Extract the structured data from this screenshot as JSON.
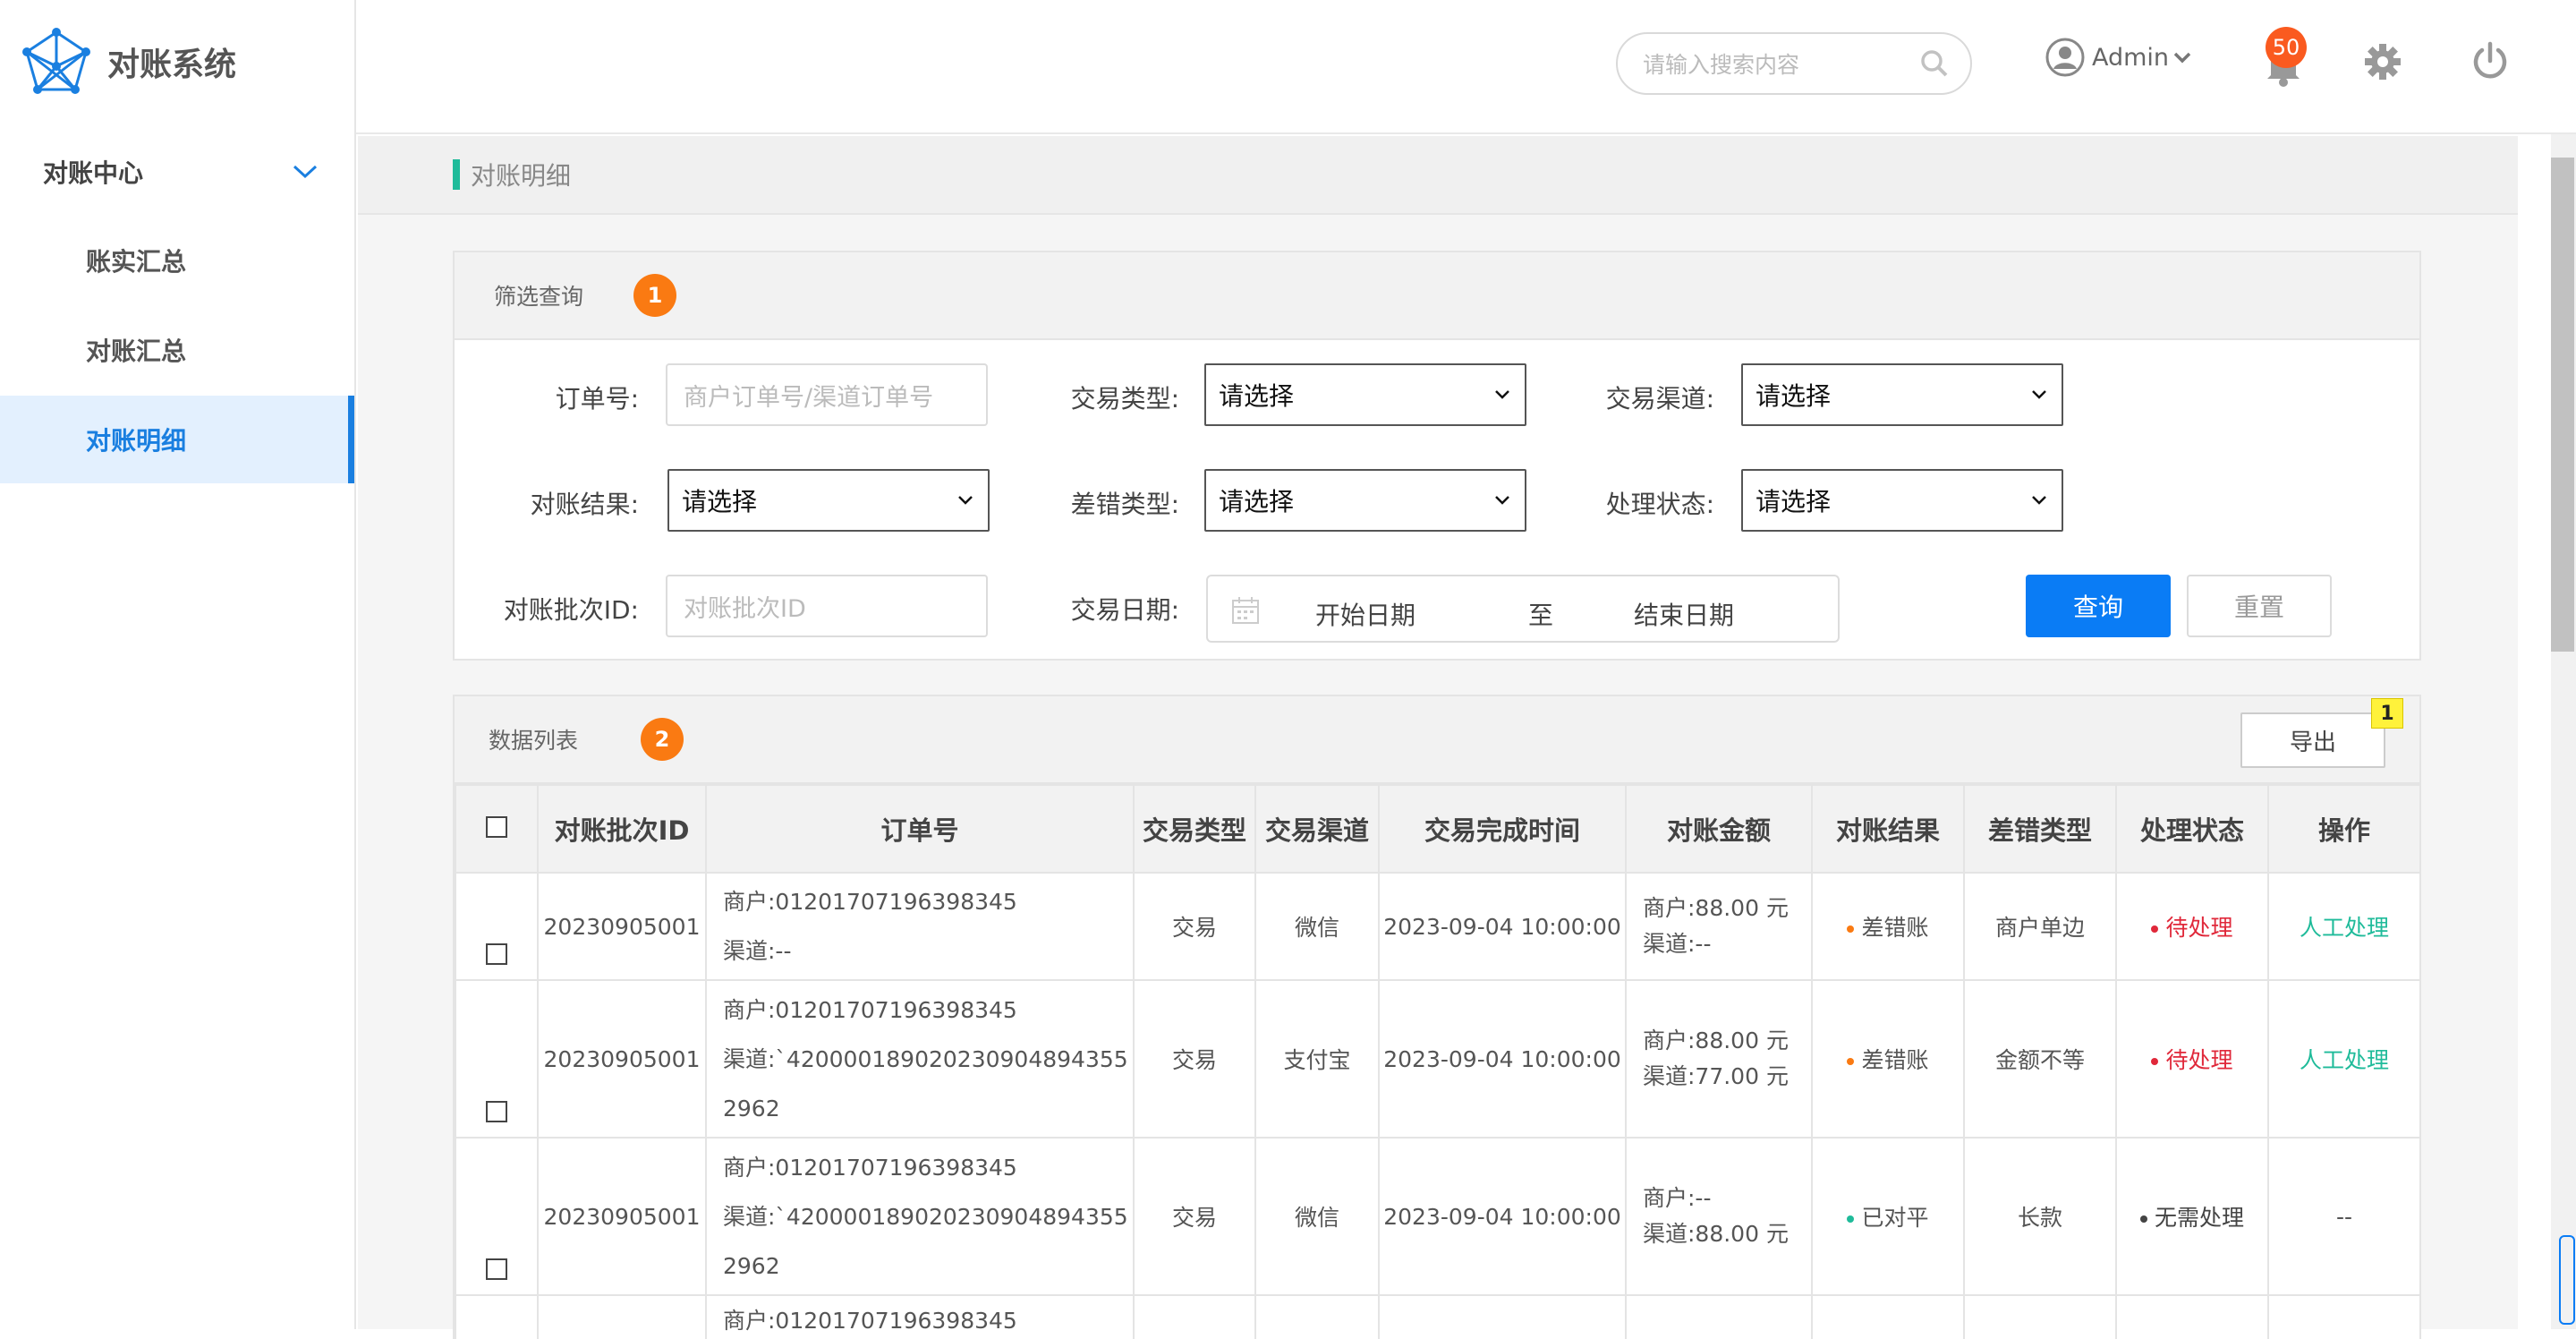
{
  "app": {
    "title": "对账系统"
  },
  "sidebar": {
    "group_label": "对账中心",
    "items": [
      {
        "label": "账实汇总"
      },
      {
        "label": "对账汇总"
      },
      {
        "label": "对账明细"
      }
    ]
  },
  "header": {
    "search_placeholder": "请输入搜索内容",
    "user_name": "Admin",
    "notification_count": "50"
  },
  "page": {
    "title": "对账明细"
  },
  "filter": {
    "panel_title": "筛选查询",
    "step": "1",
    "order_label": "订单号:",
    "order_placeholder": "商户订单号/渠道订单号",
    "trade_type_label": "交易类型:",
    "trade_type_value": "请选择",
    "channel_label": "交易渠道:",
    "channel_value": "请选择",
    "result_label": "对账结果:",
    "result_value": "请选择",
    "error_type_label": "差错类型:",
    "error_type_value": "请选择",
    "status_label": "处理状态:",
    "status_value": "请选择",
    "batch_label": "对账批次ID:",
    "batch_placeholder": "对账批次ID",
    "date_label": "交易日期:",
    "date_start": "开始日期",
    "date_to": "至",
    "date_end": "结束日期",
    "query_button": "查询",
    "reset_button": "重置"
  },
  "list": {
    "panel_title": "数据列表",
    "step": "2",
    "export_button": "导出",
    "export_badge": "1",
    "columns": [
      "对账批次ID",
      "订单号",
      "交易类型",
      "交易渠道",
      "交易完成时间",
      "对账金额",
      "对账结果",
      "差错类型",
      "处理状态",
      "操作"
    ],
    "rows": [
      {
        "batch": "20230905001",
        "merchant_order": "商户:01201707196398345",
        "channel_order": "渠道:--",
        "type": "交易",
        "channel": "微信",
        "time": "2023-09-04  10:00:00",
        "amount_merchant": "商户:88.00 元",
        "amount_channel": "渠道:--",
        "result": "差错账",
        "result_color": "#fa7a12",
        "error_type": "商户单边",
        "status": "待处理",
        "status_color": "#e0283a",
        "action": "人工处理"
      },
      {
        "batch": "20230905001",
        "merchant_order": "商户:01201707196398345",
        "channel_order": "渠道:`4200001890202309048943552962",
        "type": "交易",
        "channel": "支付宝",
        "time": "2023-09-04  10:00:00",
        "amount_merchant": "商户:88.00 元",
        "amount_channel": "渠道:77.00 元",
        "result": "差错账",
        "result_color": "#fa7a12",
        "error_type": "金额不等",
        "status": "待处理",
        "status_color": "#e0283a",
        "action": "人工处理"
      },
      {
        "batch": "20230905001",
        "merchant_order": "商户:01201707196398345",
        "channel_order": "渠道:`4200001890202309048943552962",
        "type": "交易",
        "channel": "微信",
        "time": "2023-09-04  10:00:00",
        "amount_merchant": "商户:--",
        "amount_channel": "渠道:88.00 元",
        "result": "已对平",
        "result_color": "#1fbb9a",
        "error_type": "长款",
        "status": "无需处理",
        "status_color": "#444444",
        "action": "--"
      },
      {
        "merchant_order": "商户:01201707196398345"
      }
    ]
  }
}
